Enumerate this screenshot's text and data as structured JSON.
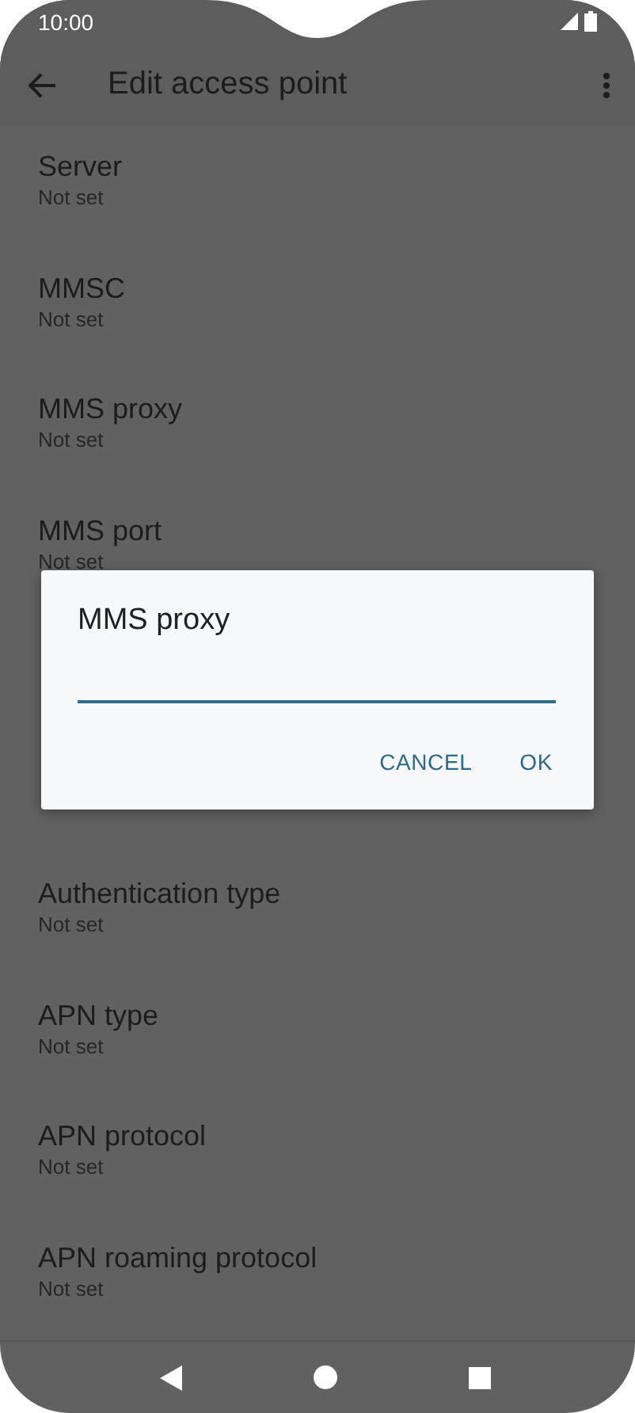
{
  "status_bar": {
    "time": "10:00"
  },
  "app_bar": {
    "title": "Edit access point"
  },
  "settings_above": [
    {
      "title": "Server",
      "summary": "Not set"
    },
    {
      "title": "MMSC",
      "summary": "Not set"
    },
    {
      "title": "MMS proxy",
      "summary": "Not set"
    },
    {
      "title": "MMS port",
      "summary": "Not set"
    }
  ],
  "settings_below": [
    {
      "title": "Authentication type",
      "summary": "Not set"
    },
    {
      "title": "APN type",
      "summary": "Not set"
    },
    {
      "title": "APN protocol",
      "summary": "Not set"
    },
    {
      "title": "APN roaming protocol",
      "summary": "Not set"
    }
  ],
  "dialog": {
    "title": "MMS proxy",
    "buttons": [
      "CANCEL",
      "OK"
    ]
  }
}
